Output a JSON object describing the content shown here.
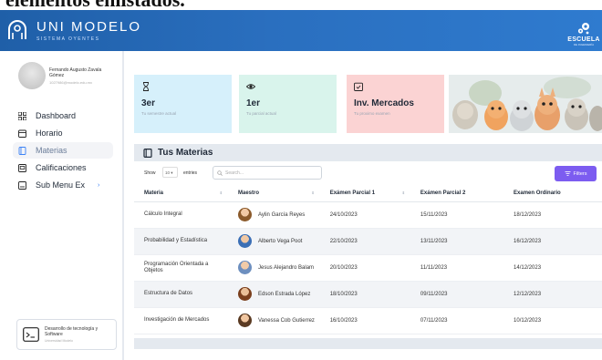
{
  "caption": "elementos enlistados.",
  "app": {
    "title": "UNI MODELO",
    "subtitle": "SISTEMA OYENTES"
  },
  "school": {
    "name": "ESCUELA",
    "sub": "DE INGENIERÍA"
  },
  "profile": {
    "name": "Fernando Augusto Zavala Gómez",
    "email": "1027986@modelo.edu.mx"
  },
  "nav": [
    {
      "label": "Dashboard",
      "icon": "grid-icon"
    },
    {
      "label": "Horario",
      "icon": "calendar-icon"
    },
    {
      "label": "Materias",
      "icon": "book-icon",
      "active": true
    },
    {
      "label": "Calificaciones",
      "icon": "grades-icon"
    },
    {
      "label": "Sub Menu Ex",
      "icon": "submenu-icon",
      "arrow": "›"
    }
  ],
  "footer": {
    "title": "Desarrollo de tecnología y Software",
    "sub": "Universidad Modelo"
  },
  "cards": [
    {
      "icon": "hourglass-icon",
      "value": "3er",
      "sub": "Tu semestre actual",
      "color": "#d6f0fb"
    },
    {
      "icon": "eye-icon",
      "value": "1er",
      "sub": "Tu parcial actual",
      "color": "#d9f4ec"
    },
    {
      "icon": "calendar-check-icon",
      "value": "Inv. Mercados",
      "sub": "Tu proximo examen",
      "color": "#fbd3d3"
    }
  ],
  "panel": {
    "title": "Tus Materias"
  },
  "controls": {
    "show": "Show",
    "entries_value": "10 ▾",
    "entries": "entries",
    "search_placeholder": "Search...",
    "filters": "Filters"
  },
  "table": {
    "columns": [
      "Materia",
      "Maestro",
      "Exámen Parcial 1",
      "Exámen Parcial 2",
      "Examen Ordinario"
    ],
    "rows": [
      {
        "materia": "Cálculo Integral",
        "maestro": "Aylin García Reyes",
        "p1": "24/10/2023",
        "p2": "15/11/2023",
        "ord": "18/12/2023"
      },
      {
        "materia": "Probabilidad y Estadística",
        "maestro": "Alberto Vega Poot",
        "p1": "22/10/2023",
        "p2": "13/11/2023",
        "ord": "16/12/2023"
      },
      {
        "materia": "Programación Orientada a Objetos",
        "maestro": "Jesus Alejandro Balam",
        "p1": "20/10/2023",
        "p2": "11/11/2023",
        "ord": "14/12/2023"
      },
      {
        "materia": "Estructura de Datos",
        "maestro": "Edson Estrada López",
        "p1": "18/10/2023",
        "p2": "09/11/2023",
        "ord": "12/12/2023"
      },
      {
        "materia": "Investigación de Mercados",
        "maestro": "Vanessa Cob Gutierrez",
        "p1": "16/10/2023",
        "p2": "07/11/2023",
        "ord": "10/12/2023"
      }
    ]
  },
  "colors": {
    "header": "#2a6fbf",
    "accent": "#7c5cf0",
    "active_nav": "#6b7d99"
  }
}
